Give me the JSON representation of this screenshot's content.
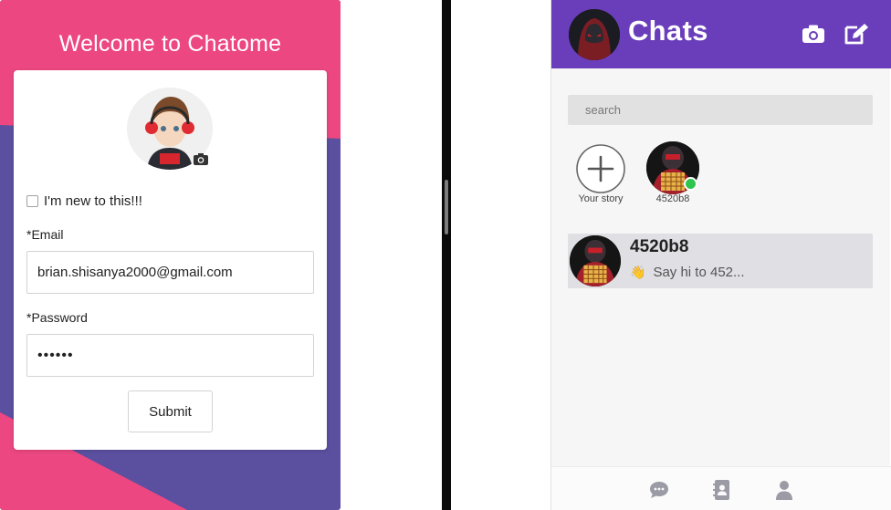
{
  "login": {
    "title": "Welcome to Chatome",
    "new_user_label": "I'm new to this!!!",
    "new_user_checked": false,
    "email_label": "*Email",
    "email_value": "brian.shisanya2000@gmail.com",
    "password_label": "*Password",
    "password_value": "••••••",
    "submit_label": "Submit",
    "profile_avatar_icon": "anime-avatar-icon",
    "camera_icon": "camera-icon"
  },
  "chat_app": {
    "title": "Chats",
    "search_placeholder": "search",
    "stories": [
      {
        "label": "Your story",
        "icon": "plus-icon"
      },
      {
        "label": "4520b8",
        "online": true
      }
    ],
    "conversations": [
      {
        "name": "4520b8",
        "preview_icon": "👋",
        "preview": "Say hi to 452..."
      }
    ],
    "header_icons": [
      "camera-icon",
      "compose-icon"
    ],
    "nav_icons": [
      "chat-bubble-icon",
      "contacts-icon",
      "profile-icon"
    ]
  },
  "colors": {
    "login_pink": "#ec4780",
    "login_purple": "#5b4fa0",
    "header_purple": "#6a3ebb",
    "online_green": "#2ec44e"
  }
}
